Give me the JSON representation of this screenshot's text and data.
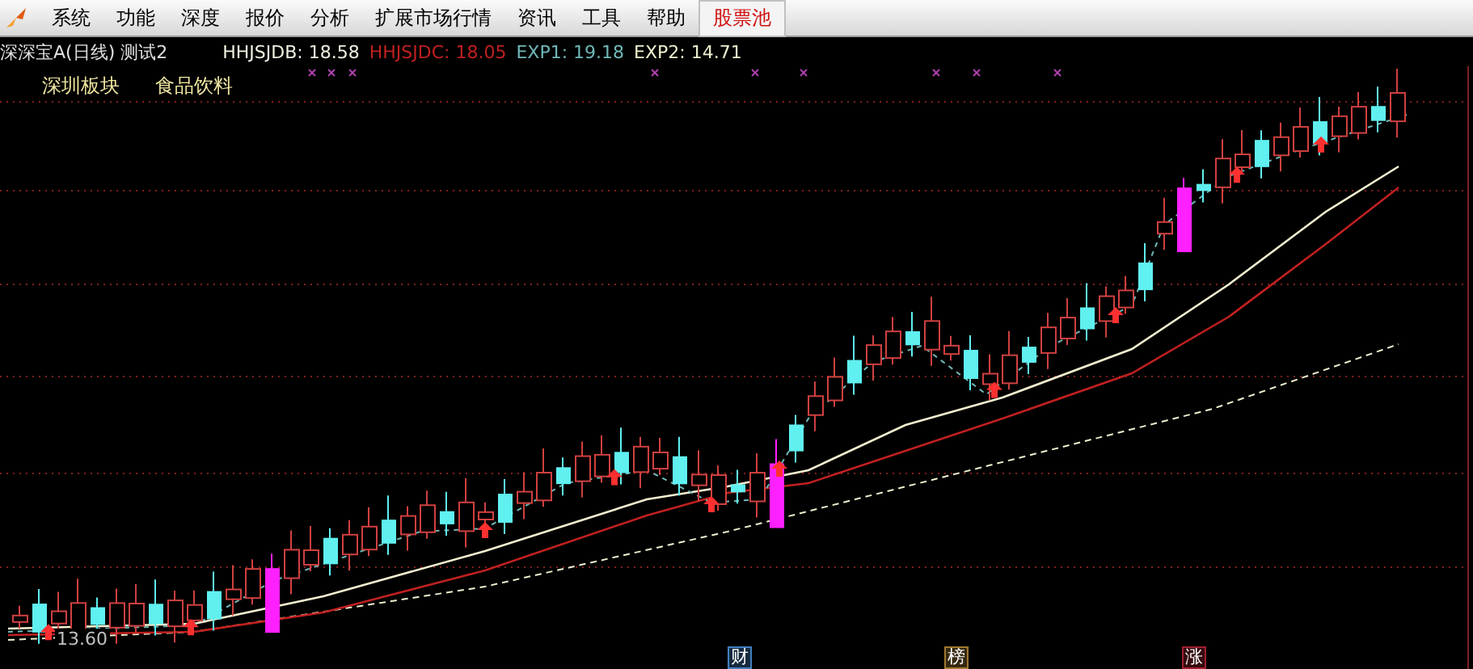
{
  "menu": [
    {
      "label": "系统",
      "kind": "plain"
    },
    {
      "label": "功能",
      "kind": "plain"
    },
    {
      "label": "深度",
      "kind": "plain"
    },
    {
      "label": "报价",
      "kind": "plain"
    },
    {
      "label": "分析",
      "kind": "plain"
    },
    {
      "label": "扩展市场行情",
      "kind": "plain"
    },
    {
      "label": "资讯",
      "kind": "plain"
    },
    {
      "label": "工具",
      "kind": "plain"
    },
    {
      "label": "帮助",
      "kind": "plain"
    },
    {
      "label": "股票池",
      "kind": "highlight"
    }
  ],
  "chart_header": {
    "title": "深深宝A(日线) 测试2",
    "indicators": [
      {
        "label": "HHJSJDB: 18.58",
        "color": "#f0f0e0"
      },
      {
        "label": "HHJSJDC: 18.05",
        "color": "#c02020"
      },
      {
        "label": "EXP1: 19.18",
        "color": "#70b8b8"
      },
      {
        "label": "EXP2: 14.71",
        "color": "#f0f0d0"
      }
    ]
  },
  "tags": [
    "深圳板块",
    "食品饮料"
  ],
  "price_label": "13.60",
  "event_markers": [
    {
      "label": "财",
      "color": "#4080c0"
    },
    {
      "label": "榜",
      "color": "#a07830"
    },
    {
      "label": "涨",
      "color": "#a02030"
    }
  ]
}
